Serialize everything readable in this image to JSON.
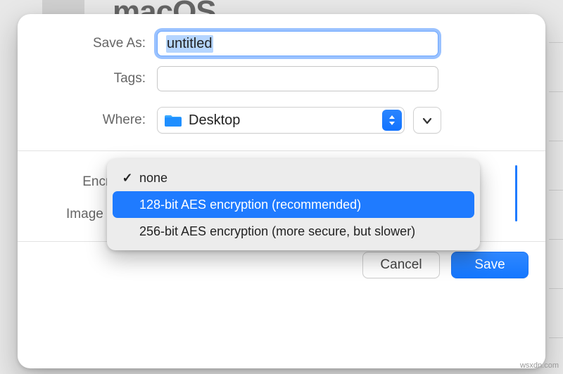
{
  "background": {
    "title": "macOS"
  },
  "dialog": {
    "save_as_label": "Save As:",
    "save_as_value": "untitled",
    "tags_label": "Tags:",
    "tags_value": "",
    "where_label": "Where:",
    "where_value": "Desktop",
    "encryption_label": "Encryption",
    "image_format_label": "Image Forma",
    "cancel_label": "Cancel",
    "save_label": "Save"
  },
  "encryption_menu": {
    "items": [
      {
        "label": "none",
        "checked": true
      },
      {
        "label": "128-bit AES encryption (recommended)",
        "checked": false
      },
      {
        "label": "256-bit AES encryption (more secure, but slower)",
        "checked": false
      }
    ],
    "highlighted_index": 1
  },
  "watermark": "wsxdn.com"
}
